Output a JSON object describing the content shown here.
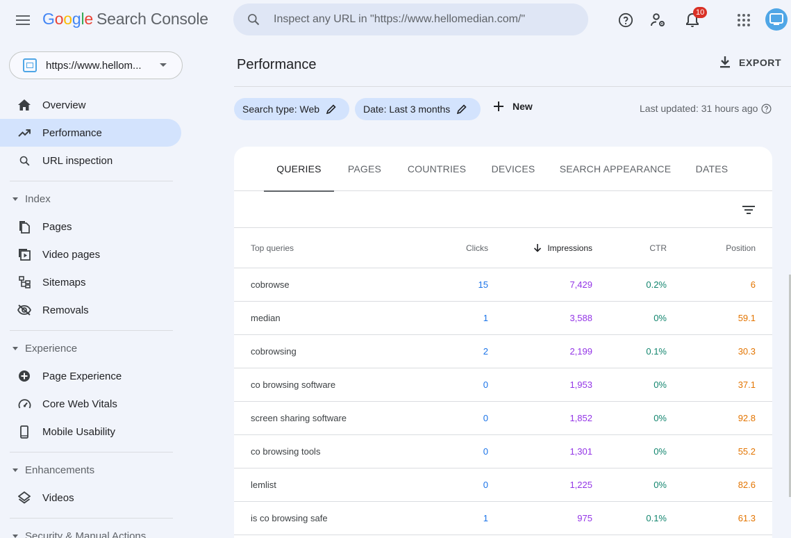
{
  "header": {
    "logo_letters": [
      "G",
      "o",
      "o",
      "g",
      "l",
      "e"
    ],
    "product_name": "Search Console",
    "search_placeholder": "Inspect any URL in \"https://www.hellomedian.com/\"",
    "notification_count": "10"
  },
  "sidebar": {
    "property_label": "https://www.hellom...",
    "items_top": [
      {
        "label": "Overview",
        "icon": "home-icon"
      },
      {
        "label": "Performance",
        "icon": "trending-up-icon",
        "active": true
      },
      {
        "label": "URL inspection",
        "icon": "search-icon"
      }
    ],
    "index_label": "Index",
    "index_items": [
      {
        "label": "Pages",
        "icon": "pages-icon"
      },
      {
        "label": "Video pages",
        "icon": "video-pages-icon"
      },
      {
        "label": "Sitemaps",
        "icon": "sitemap-icon"
      },
      {
        "label": "Removals",
        "icon": "visibility-off-icon"
      }
    ],
    "experience_label": "Experience",
    "experience_items": [
      {
        "label": "Page Experience",
        "icon": "page-experience-icon"
      },
      {
        "label": "Core Web Vitals",
        "icon": "speed-icon"
      },
      {
        "label": "Mobile Usability",
        "icon": "smartphone-icon"
      }
    ],
    "enhancements_label": "Enhancements",
    "enhancements_items": [
      {
        "label": "Videos",
        "icon": "layers-icon"
      }
    ],
    "security_label": "Security & Manual Actions"
  },
  "main": {
    "title": "Performance",
    "export_label": "EXPORT",
    "chips": {
      "search_type": "Search type: Web",
      "date": "Date: Last 3 months"
    },
    "new_label": "New",
    "last_updated": "Last updated: 31 hours ago"
  },
  "tabs": [
    "QUERIES",
    "PAGES",
    "COUNTRIES",
    "DEVICES",
    "SEARCH APPEARANCE",
    "DATES"
  ],
  "table": {
    "headers": {
      "query": "Top queries",
      "clicks": "Clicks",
      "impressions": "Impressions",
      "ctr": "CTR",
      "position": "Position"
    },
    "rows": [
      {
        "query": "cobrowse",
        "clicks": "15",
        "impressions": "7,429",
        "ctr": "0.2%",
        "position": "6"
      },
      {
        "query": "median",
        "clicks": "1",
        "impressions": "3,588",
        "ctr": "0%",
        "position": "59.1"
      },
      {
        "query": "cobrowsing",
        "clicks": "2",
        "impressions": "2,199",
        "ctr": "0.1%",
        "position": "30.3"
      },
      {
        "query": "co browsing software",
        "clicks": "0",
        "impressions": "1,953",
        "ctr": "0%",
        "position": "37.1"
      },
      {
        "query": "screen sharing software",
        "clicks": "0",
        "impressions": "1,852",
        "ctr": "0%",
        "position": "92.8"
      },
      {
        "query": "co browsing tools",
        "clicks": "0",
        "impressions": "1,301",
        "ctr": "0%",
        "position": "55.2"
      },
      {
        "query": "lemlist",
        "clicks": "0",
        "impressions": "1,225",
        "ctr": "0%",
        "position": "82.6"
      },
      {
        "query": "is co browsing safe",
        "clicks": "1",
        "impressions": "975",
        "ctr": "0.1%",
        "position": "61.3"
      }
    ]
  },
  "colors": {
    "active_nav": "#d3e3fd",
    "clicks": "#1a73e8",
    "impressions": "#9334e6",
    "ctr": "#12856e",
    "position": "#e37400",
    "badge": "#d93025"
  }
}
